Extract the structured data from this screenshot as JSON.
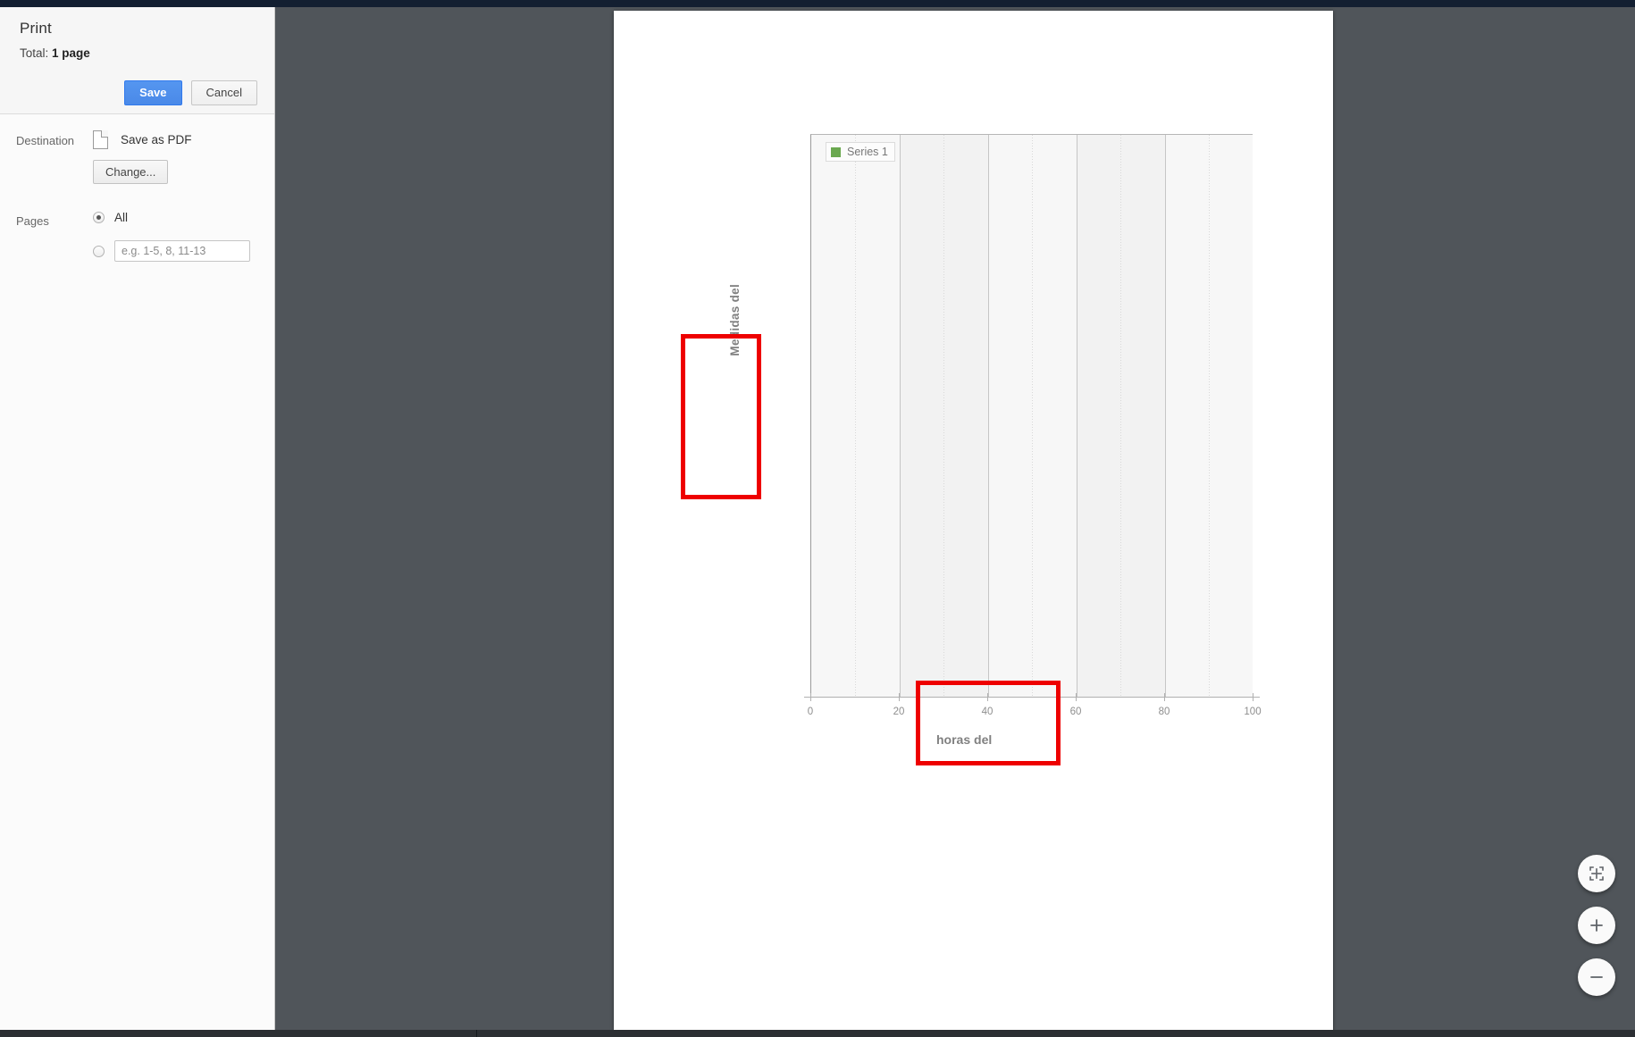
{
  "dialog": {
    "title": "Print",
    "total_prefix": "Total:",
    "total_value": "1 page",
    "save_label": "Save",
    "cancel_label": "Cancel",
    "destination_label": "Destination",
    "destination_value": "Save as PDF",
    "destination_icon": "document-icon",
    "change_label": "Change...",
    "pages_label": "Pages",
    "pages_all_label": "All",
    "pages_range_placeholder": "e.g. 1-5, 8, 11-13",
    "pages_range_value": "",
    "accent_color": "#4a89e8"
  },
  "viewer": {
    "fit_icon": "fit-to-page-icon",
    "zoom_in_icon": "plus-icon",
    "zoom_out_icon": "minus-icon",
    "backdrop_color": "#50555a"
  },
  "annotations": {
    "ylabel_highlight_color": "#ee0000",
    "xlabel_highlight_color": "#ee0000"
  },
  "chart_data": {
    "type": "scatter",
    "title": "",
    "xlabel": "horas del",
    "ylabel": "Medidas del",
    "series": [
      {
        "name": "Series 1",
        "color": "#6aa84f",
        "x": [],
        "y": []
      }
    ],
    "legend": {
      "position": "top-left",
      "entries": [
        {
          "label": "Series 1",
          "color": "#6aa84f"
        }
      ]
    },
    "xlim": [
      0,
      100
    ],
    "xticks": [
      0,
      20,
      40,
      60,
      80,
      100
    ],
    "xtick_labels": [
      "0",
      "20",
      "40",
      "60",
      "80",
      "100"
    ],
    "ylim": [
      0,
      1
    ],
    "yticks": [],
    "ytick_labels": [],
    "grid": {
      "major_x": [
        20,
        40,
        60,
        80
      ],
      "minor_x": [
        10,
        30,
        50,
        70,
        90
      ],
      "alternating_bands": true
    }
  }
}
